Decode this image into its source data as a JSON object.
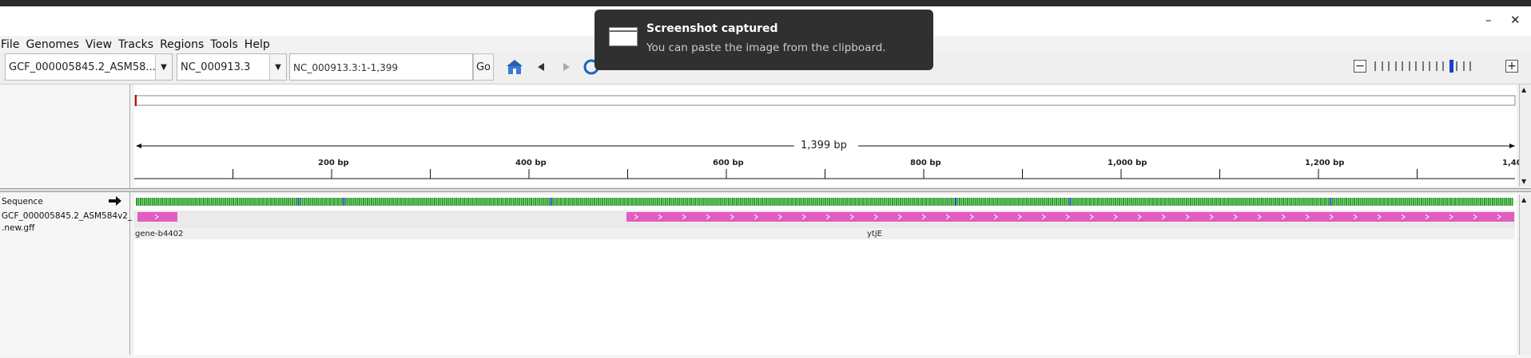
{
  "window": {
    "minimize": "–",
    "close": "✕"
  },
  "menu": [
    "File",
    "Genomes",
    "View",
    "Tracks",
    "Regions",
    "Tools",
    "Help"
  ],
  "toolbar": {
    "genome": "GCF_000005845.2_ASM58...",
    "chromosome": "NC_000913.3",
    "locus": "NC_000913.3:1-1,399",
    "go": "Go"
  },
  "ruler": {
    "span_label": "1,399 bp",
    "ticks": [
      "200 bp",
      "400 bp",
      "600 bp",
      "800 bp",
      "1,000 bp",
      "1,200 bp",
      "1,40"
    ]
  },
  "tracks": {
    "sequence_label": "Sequence",
    "gff_label_line1": "GCF_000005845.2_ASM584v2_",
    "gff_label_line2": ".new.gff",
    "features": [
      {
        "name": "gene-b4402"
      },
      {
        "name": "ytjE"
      }
    ]
  },
  "toast": {
    "title": "Screenshot captured",
    "body": "You can paste the image from the clipboard."
  },
  "colors": {
    "feature": "#e45cc0",
    "region_marker": "#d00000"
  }
}
